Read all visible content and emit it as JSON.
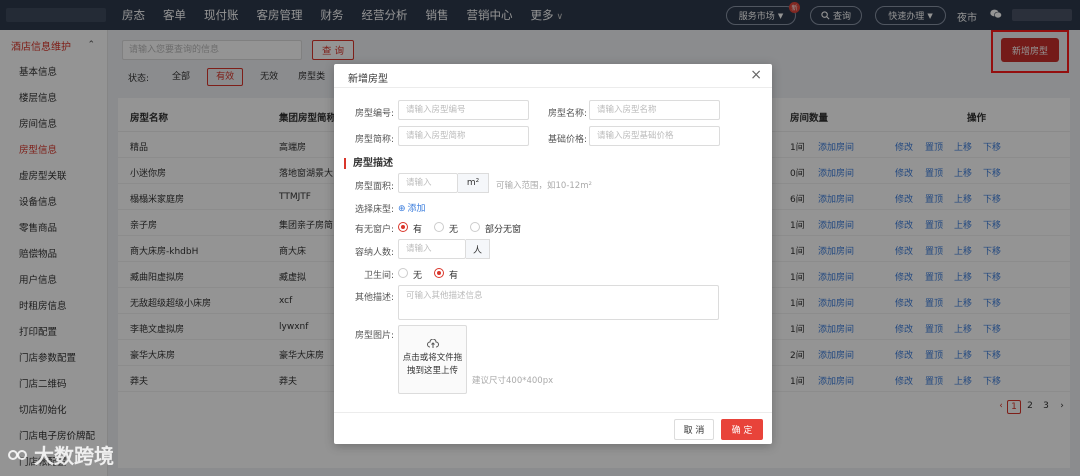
{
  "topnav": {
    "menu": [
      "房态",
      "客单",
      "现付账",
      "客房管理",
      "财务",
      "经营分析",
      "销售",
      "营销中心",
      "更多"
    ],
    "service_market": "服务市场",
    "new_badge": "新",
    "search": "查询",
    "quick": "快速办理",
    "night": "夜市"
  },
  "sidebar": {
    "group": "酒店信息维护",
    "items": [
      "基本信息",
      "楼层信息",
      "房间信息",
      "房型信息",
      "虚房型关联",
      "设备信息",
      "零售商品",
      "赔偿物品",
      "用户信息",
      "时租房信息",
      "打印配置",
      "门店参数配置",
      "门店二维码",
      "切店初始化",
      "门店电子房价牌配",
      "门店帐配置"
    ],
    "active_index": 3
  },
  "toolbar": {
    "search_placeholder": "请输入您要查询的信息",
    "query_button": "查 询",
    "new_room_type": "新增房型",
    "status_label": "状态:",
    "filters": [
      "全部",
      "有效",
      "无效",
      "房型类"
    ],
    "active_filter": 1
  },
  "table": {
    "headers": {
      "name": "房型名称",
      "group_name": "集团房型简称",
      "room_count": "房间数量",
      "actions": "操作"
    },
    "add_room": "添加房间",
    "actions": [
      "修改",
      "置顶",
      "上移",
      "下移"
    ],
    "rows": [
      {
        "name": "精品",
        "group": "高端房",
        "count": "1间"
      },
      {
        "name": "小迷你房",
        "group": "落地窗湖景大",
        "count": "0间"
      },
      {
        "name": "榻榻米家庭房",
        "group": "TTMJTF",
        "count": "6间"
      },
      {
        "name": "亲子房",
        "group": "集团亲子房简",
        "count": "1间"
      },
      {
        "name": "商大床房-khdbH",
        "group": "商大床",
        "count": "1间"
      },
      {
        "name": "臧曲阳虚拟房",
        "group": "臧虚拟",
        "count": "1间"
      },
      {
        "name": "无敌超级超级小床房",
        "group": "xcf",
        "count": "1间"
      },
      {
        "name": "李艳文虚拟房",
        "group": "lywxnf",
        "count": "1间"
      },
      {
        "name": "豪华大床房",
        "group": "豪华大床房",
        "count": "2间"
      },
      {
        "name": "莽夫",
        "group": "莽夫",
        "count": "1间"
      }
    ],
    "pager": {
      "prev": "‹",
      "pages": [
        "1",
        "2",
        "3"
      ],
      "next": "›",
      "current": "1"
    }
  },
  "modal": {
    "title": "新增房型",
    "close": "×",
    "fields": {
      "code_label": "房型编号:",
      "code_placeholder": "请输入房型编号",
      "name_label": "房型名称:",
      "name_placeholder": "请输入房型名称",
      "short_label": "房型简称:",
      "short_placeholder": "请输入房型简称",
      "price_label": "基础价格:",
      "price_placeholder": "请输入房型基础价格"
    },
    "section": "房型描述",
    "area_label": "房型面积:",
    "area_placeholder": "请输入",
    "area_unit": "m²",
    "area_hint": "可输入范围，如10-12m²",
    "bed_label": "选择床型:",
    "bed_add": "添加",
    "window_label": "有无窗户:",
    "window_options": [
      "有",
      "无",
      "部分无窗"
    ],
    "window_selected": 0,
    "capacity_label": "容纳人数:",
    "capacity_placeholder": "请输入",
    "capacity_unit": "人",
    "bath_label": "卫生间:",
    "bath_options": [
      "无",
      "有"
    ],
    "bath_selected": 1,
    "other_label": "其他描述:",
    "other_placeholder": "可输入其他描述信息",
    "image_label": "房型图片:",
    "upload_text_1": "点击或将文件拖",
    "upload_text_2": "拽到这里上传",
    "image_hint": "建议尺寸400*400px",
    "cancel": "取 消",
    "ok": "确 定"
  },
  "watermark": "大数跨境",
  "colors": {
    "brand_red": "#d9362b",
    "nav_bg": "#2e3a4d",
    "link": "#3b7ddd"
  }
}
